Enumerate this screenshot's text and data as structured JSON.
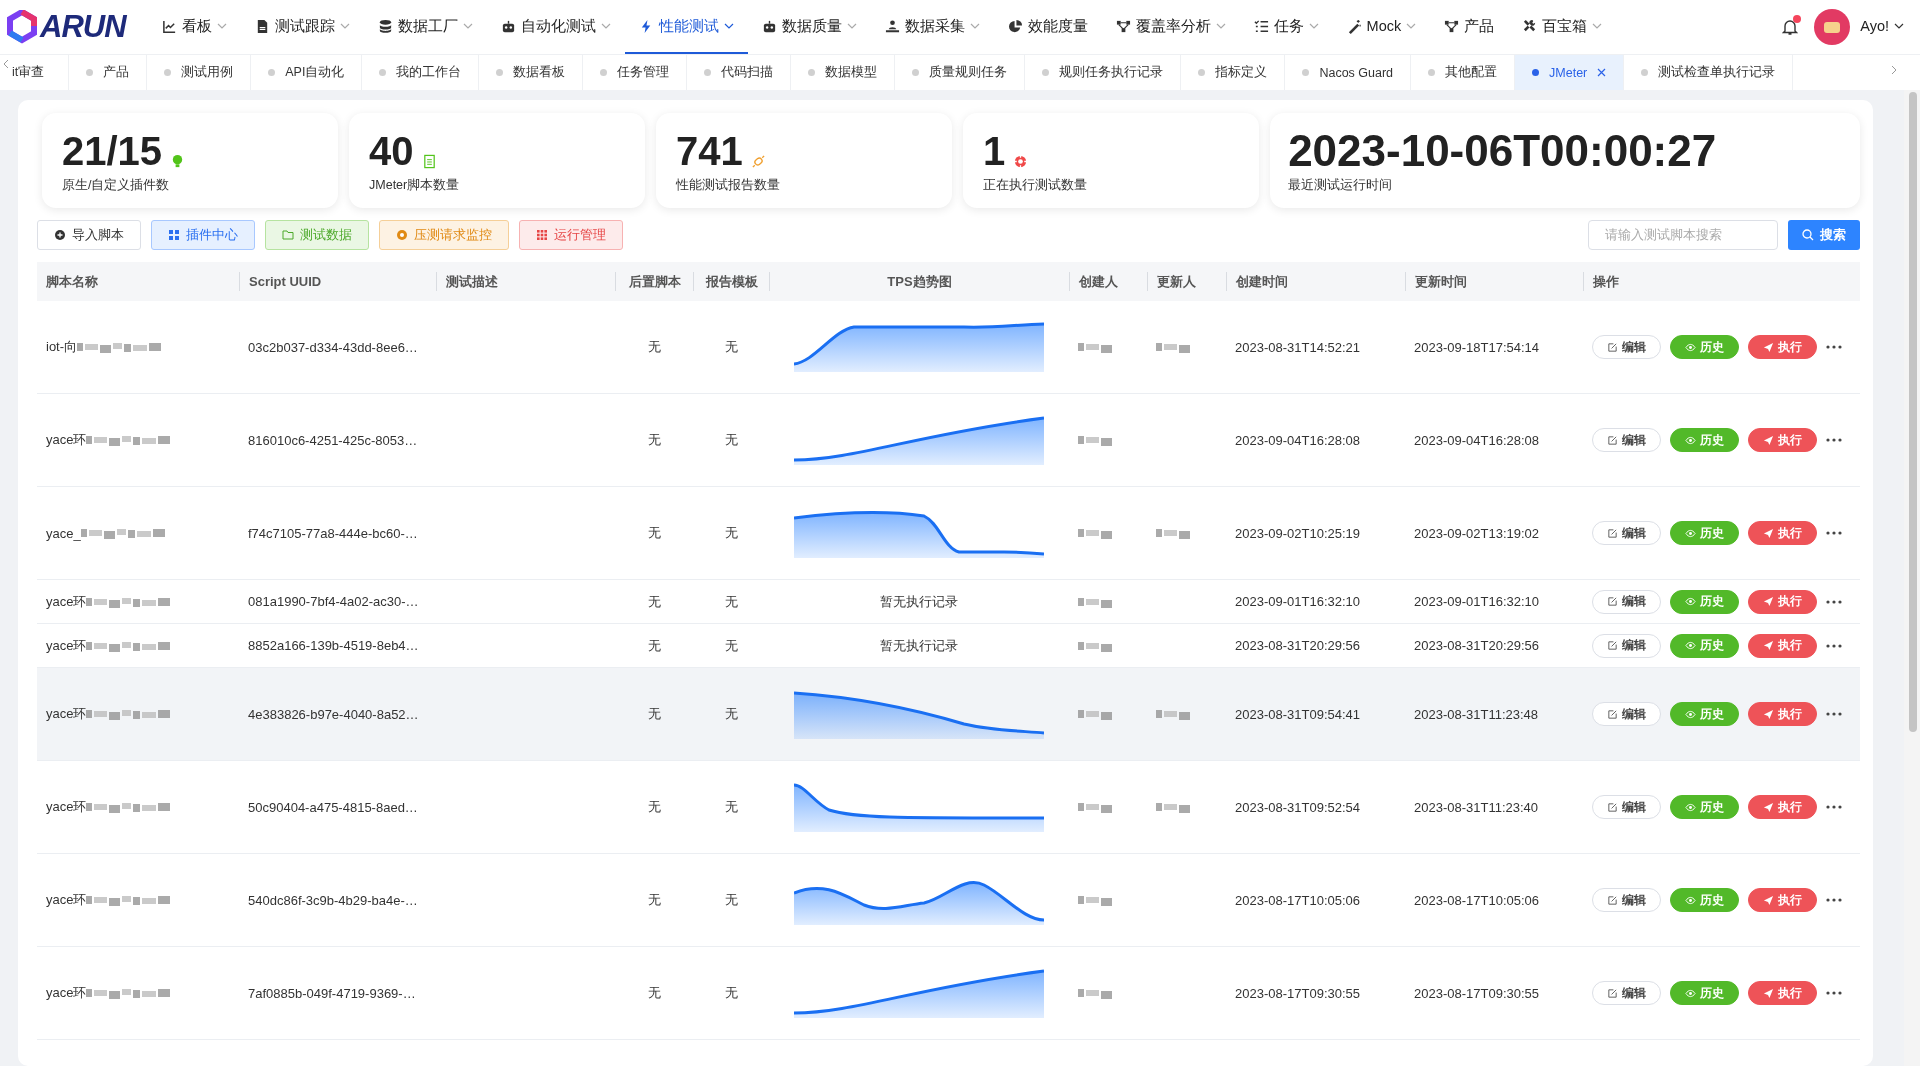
{
  "nav": {
    "logo": "ARUN",
    "menus": [
      {
        "label": "看板",
        "dropdown": true,
        "selected": false
      },
      {
        "label": "测试跟踪",
        "dropdown": true,
        "selected": false
      },
      {
        "label": "数据工厂",
        "dropdown": true,
        "selected": false
      },
      {
        "label": "自动化测试",
        "dropdown": true,
        "selected": false
      },
      {
        "label": "性能测试",
        "dropdown": true,
        "selected": true
      },
      {
        "label": "数据质量",
        "dropdown": true,
        "selected": false
      },
      {
        "label": "数据采集",
        "dropdown": true,
        "selected": false
      },
      {
        "label": "效能度量",
        "dropdown": false,
        "selected": false
      },
      {
        "label": "覆盖率分析",
        "dropdown": true,
        "selected": false
      },
      {
        "label": "任务",
        "dropdown": true,
        "selected": false
      },
      {
        "label": "Mock",
        "dropdown": true,
        "selected": false
      },
      {
        "label": "产品",
        "dropdown": false,
        "selected": false
      },
      {
        "label": "百宝箱",
        "dropdown": true,
        "selected": false
      }
    ],
    "user": {
      "name": "Ayo!",
      "notification": true
    }
  },
  "tabs": [
    {
      "label": "it审查",
      "selected": false,
      "closable": false,
      "dot": false
    },
    {
      "label": "产品",
      "selected": false,
      "closable": false,
      "dot": true
    },
    {
      "label": "测试用例",
      "selected": false,
      "closable": false,
      "dot": true
    },
    {
      "label": "API自动化",
      "selected": false,
      "closable": false,
      "dot": true
    },
    {
      "label": "我的工作台",
      "selected": false,
      "closable": false,
      "dot": true
    },
    {
      "label": "数据看板",
      "selected": false,
      "closable": false,
      "dot": true
    },
    {
      "label": "任务管理",
      "selected": false,
      "closable": false,
      "dot": true
    },
    {
      "label": "代码扫描",
      "selected": false,
      "closable": false,
      "dot": true
    },
    {
      "label": "数据模型",
      "selected": false,
      "closable": false,
      "dot": true
    },
    {
      "label": "质量规则任务",
      "selected": false,
      "closable": false,
      "dot": true
    },
    {
      "label": "规则任务执行记录",
      "selected": false,
      "closable": false,
      "dot": true
    },
    {
      "label": "指标定义",
      "selected": false,
      "closable": false,
      "dot": true
    },
    {
      "label": "Nacos Guard",
      "selected": false,
      "closable": false,
      "dot": true
    },
    {
      "label": "其他配置",
      "selected": false,
      "closable": false,
      "dot": true
    },
    {
      "label": "JMeter",
      "selected": true,
      "closable": true,
      "dot": true
    },
    {
      "label": "测试检查单执行记录",
      "selected": false,
      "closable": false,
      "dot": true
    }
  ],
  "stats": [
    {
      "value": "21/15",
      "label": "原生/自定义插件数"
    },
    {
      "value": "40",
      "label": "JMeter脚本数量"
    },
    {
      "value": "741",
      "label": "性能测试报告数量"
    },
    {
      "value": "1",
      "label": "正在执行测试数量"
    },
    {
      "value": "2023-10-06T00:00:27",
      "label": "最近测试运行时间"
    }
  ],
  "toolbar": {
    "buttons": [
      {
        "label": "导入脚本",
        "kind": "default"
      },
      {
        "label": "插件中心",
        "kind": "primary"
      },
      {
        "label": "测试数据",
        "kind": "success"
      },
      {
        "label": "压测请求监控",
        "kind": "warning"
      },
      {
        "label": "运行管理",
        "kind": "danger"
      }
    ],
    "search": {
      "placeholder": "请输入测试脚本搜索",
      "button": "搜索"
    }
  },
  "table": {
    "columns": [
      "脚本名称",
      "Script UUID",
      "测试描述",
      "后置脚本",
      "报告模板",
      "TPS趋势图",
      "创建人",
      "更新人",
      "创建时间",
      "更新时间",
      "操作"
    ],
    "rows": [
      {
        "name": "iot-向",
        "name_redacted": true,
        "uuid": "03c2b037-d334-43dd-8ee6…",
        "post_script": "无",
        "report_template": "无",
        "kind": "chart",
        "creator_redacted": true,
        "updater_redacted": true,
        "created": "2023-08-31T14:52:21",
        "updated": "2023-09-18T17:54:14",
        "highlighted": false,
        "actions": [
          "编辑",
          "历史",
          "执行"
        ]
      },
      {
        "name": "yace环",
        "name_redacted": true,
        "uuid": "816010c6-4251-425c-8053…",
        "post_script": "无",
        "report_template": "无",
        "kind": "chart",
        "creator_redacted": true,
        "updater_redacted": false,
        "created": "2023-09-04T16:28:08",
        "updated": "2023-09-04T16:28:08",
        "highlighted": false,
        "actions": [
          "编辑",
          "历史",
          "执行"
        ]
      },
      {
        "name": "yace_",
        "name_redacted": true,
        "uuid": "f74c7105-77a8-444e-bc60-…",
        "post_script": "无",
        "report_template": "无",
        "kind": "chart",
        "creator_redacted": true,
        "updater_redacted": true,
        "created": "2023-09-02T10:25:19",
        "updated": "2023-09-02T13:19:02",
        "highlighted": false,
        "actions": [
          "编辑",
          "历史",
          "执行"
        ]
      },
      {
        "name": "yace环",
        "name_redacted": true,
        "uuid": "081a1990-7bf4-4a02-ac30-…",
        "post_script": "无",
        "report_template": "无",
        "kind": "empty",
        "tps_empty": "暂无执行记录",
        "creator_redacted": true,
        "updater_redacted": false,
        "created": "2023-09-01T16:32:10",
        "updated": "2023-09-01T16:32:10",
        "highlighted": false,
        "actions": [
          "编辑",
          "历史",
          "执行"
        ]
      },
      {
        "name": "yace环",
        "name_redacted": true,
        "uuid": "8852a166-139b-4519-8eb4…",
        "post_script": "无",
        "report_template": "无",
        "kind": "empty",
        "tps_empty": "暂无执行记录",
        "creator_redacted": true,
        "updater_redacted": false,
        "created": "2023-08-31T20:29:56",
        "updated": "2023-08-31T20:29:56",
        "highlighted": false,
        "actions": [
          "编辑",
          "历史",
          "执行"
        ]
      },
      {
        "name": "yace环",
        "name_redacted": true,
        "uuid": "4e383826-b97e-4040-8a52…",
        "post_script": "无",
        "report_template": "无",
        "kind": "chart",
        "creator_redacted": true,
        "updater_redacted": true,
        "created": "2023-08-31T09:54:41",
        "updated": "2023-08-31T11:23:48",
        "highlighted": true,
        "actions": [
          "编辑",
          "历史",
          "执行"
        ]
      },
      {
        "name": "yace环",
        "name_redacted": true,
        "uuid": "50c90404-a475-4815-8aed…",
        "post_script": "无",
        "report_template": "无",
        "kind": "chart",
        "creator_redacted": true,
        "updater_redacted": true,
        "created": "2023-08-31T09:52:54",
        "updated": "2023-08-31T11:23:40",
        "highlighted": false,
        "actions": [
          "编辑",
          "历史",
          "执行"
        ]
      },
      {
        "name": "yace环",
        "name_redacted": true,
        "uuid": "540dc86f-3c9b-4b29-ba4e-…",
        "post_script": "无",
        "report_template": "无",
        "kind": "chart",
        "creator_redacted": true,
        "updater_redacted": false,
        "created": "2023-08-17T10:05:06",
        "updated": "2023-08-17T10:05:06",
        "highlighted": false,
        "actions": [
          "编辑",
          "历史",
          "执行"
        ]
      },
      {
        "name": "yace环",
        "name_redacted": true,
        "uuid": "7af0885b-049f-4719-9369-…",
        "post_script": "无",
        "report_template": "无",
        "kind": "chart",
        "creator_redacted": true,
        "updater_redacted": false,
        "created": "2023-08-17T09:30:55",
        "updated": "2023-08-17T09:30:55",
        "highlighted": false,
        "actions": [
          "编辑",
          "历史",
          "执行"
        ]
      }
    ]
  }
}
